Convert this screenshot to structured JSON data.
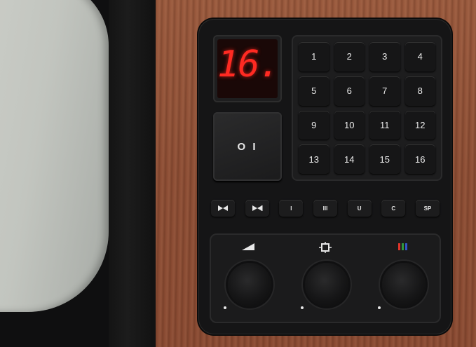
{
  "display": {
    "channel": "16."
  },
  "power": {
    "label": "O I"
  },
  "keypad": {
    "keys": [
      "1",
      "2",
      "3",
      "4",
      "5",
      "6",
      "7",
      "8",
      "9",
      "10",
      "11",
      "12",
      "13",
      "14",
      "15",
      "16"
    ]
  },
  "function_keys": [
    {
      "name": "search-down-key",
      "icon": "search-down-icon",
      "label": ""
    },
    {
      "name": "search-up-key",
      "icon": "search-up-icon",
      "label": ""
    },
    {
      "name": "band-i-key",
      "label": "I"
    },
    {
      "name": "band-iii-key",
      "label": "III"
    },
    {
      "name": "band-u-key",
      "label": "U"
    },
    {
      "name": "c-key",
      "label": "C"
    },
    {
      "name": "sp-key",
      "label": "SP"
    }
  ],
  "knobs": [
    {
      "name": "volume-knob",
      "icon": "volume-icon"
    },
    {
      "name": "brightness-knob",
      "icon": "brightness-icon"
    },
    {
      "name": "color-knob",
      "icon": "color-icon"
    }
  ],
  "colors": {
    "led": "#ff2a22",
    "wood": "#8d4e35",
    "panel": "#151516"
  }
}
